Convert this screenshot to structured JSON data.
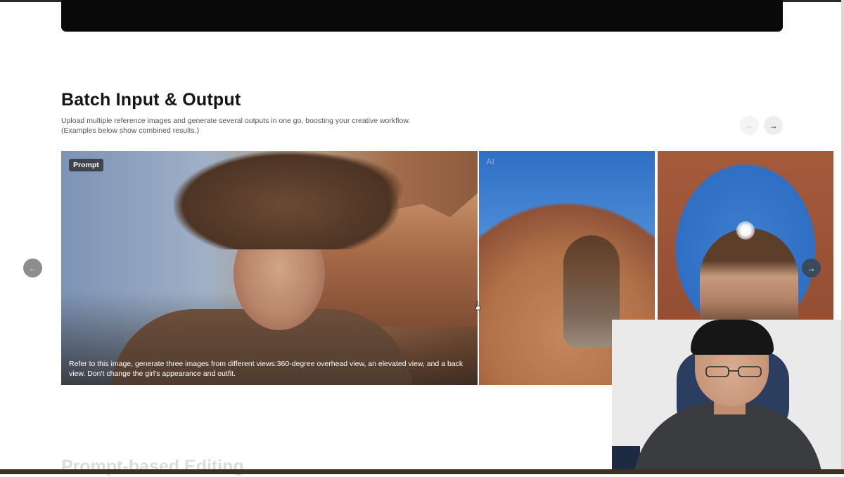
{
  "section": {
    "title": "Batch Input & Output",
    "description_line1": "Upload multiple reference images and generate several outputs in one go, boosting your creative workflow.",
    "description_line2": "(Examples below show combined results.)"
  },
  "carousel": {
    "prev_icon": "arrow-left-icon",
    "next_icon": "arrow-right-icon",
    "cards": [
      {
        "badge": "Prompt",
        "caption": "Refer to this image, generate three images from different views:360-degree overhead view, an elevated view, and a back view. Don't change the girl's appearance and outfit."
      },
      {
        "badge": "AI"
      },
      {
        "badge": ""
      }
    ]
  },
  "next_section": {
    "title": "Prompt-based Editing"
  },
  "colors": {
    "background": "#ffffff",
    "title": "#151515",
    "description": "#555555",
    "nav_next_bg": "#3a4a5c"
  }
}
